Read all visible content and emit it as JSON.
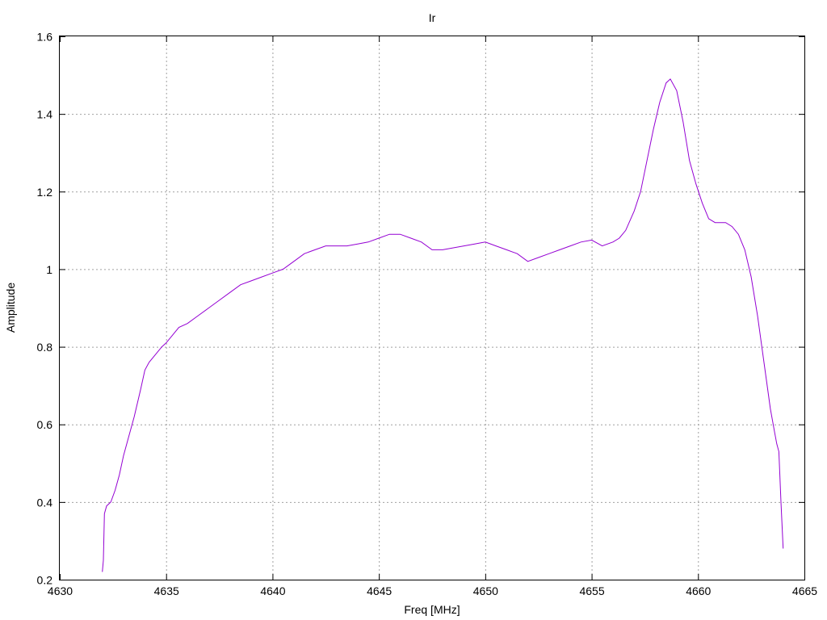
{
  "chart_data": {
    "type": "line",
    "title": "Ir",
    "xlabel": "Freq [MHz]",
    "ylabel": "Amplitude",
    "xlim": [
      4630,
      4665
    ],
    "ylim": [
      0.2,
      1.6
    ],
    "x_ticks": [
      "4630",
      "4635",
      "4640",
      "4645",
      "4650",
      "4655",
      "4660",
      "4665"
    ],
    "y_ticks": [
      "0.2",
      "0.4",
      "0.6",
      "0.8",
      "1",
      "1.2",
      "1.4",
      "1.6"
    ],
    "grid": true,
    "legend": "none",
    "series": [
      {
        "color": "#9400d3",
        "x": [
          4632.0,
          4632.05,
          4632.1,
          4632.2,
          4632.4,
          4632.6,
          4632.8,
          4633.0,
          4633.2,
          4633.5,
          4633.8,
          4634.0,
          4634.2,
          4634.5,
          4634.8,
          4635.0,
          4635.3,
          4635.6,
          4636.0,
          4636.5,
          4637.0,
          4637.5,
          4638.0,
          4638.5,
          4639.0,
          4639.5,
          4640.0,
          4640.5,
          4641.0,
          4641.5,
          4642.0,
          4642.5,
          4643.0,
          4643.5,
          4644.0,
          4644.5,
          4645.0,
          4645.5,
          4646.0,
          4646.5,
          4647.0,
          4647.5,
          4648.0,
          4648.5,
          4649.0,
          4649.5,
          4650.0,
          4650.5,
          4651.0,
          4651.5,
          4652.0,
          4652.5,
          4653.0,
          4653.5,
          4654.0,
          4654.5,
          4655.0,
          4655.5,
          4656.0,
          4656.3,
          4656.6,
          4657.0,
          4657.3,
          4657.6,
          4657.9,
          4658.2,
          4658.5,
          4658.7,
          4659.0,
          4659.3,
          4659.6,
          4659.9,
          4660.2,
          4660.5,
          4660.8,
          4661.0,
          4661.3,
          4661.6,
          4661.9,
          4662.2,
          4662.5,
          4662.8,
          4663.0,
          4663.2,
          4663.4,
          4663.6,
          4663.7,
          4663.8,
          4663.9,
          4664.0
        ],
        "y": [
          0.22,
          0.25,
          0.37,
          0.39,
          0.4,
          0.43,
          0.47,
          0.52,
          0.56,
          0.62,
          0.69,
          0.74,
          0.76,
          0.78,
          0.8,
          0.81,
          0.83,
          0.85,
          0.86,
          0.88,
          0.9,
          0.92,
          0.94,
          0.96,
          0.97,
          0.98,
          0.99,
          1.0,
          1.02,
          1.04,
          1.05,
          1.06,
          1.06,
          1.06,
          1.065,
          1.07,
          1.08,
          1.09,
          1.09,
          1.08,
          1.07,
          1.05,
          1.05,
          1.055,
          1.06,
          1.065,
          1.07,
          1.06,
          1.05,
          1.04,
          1.02,
          1.03,
          1.04,
          1.05,
          1.06,
          1.07,
          1.075,
          1.06,
          1.07,
          1.08,
          1.1,
          1.15,
          1.2,
          1.28,
          1.36,
          1.43,
          1.48,
          1.49,
          1.46,
          1.38,
          1.28,
          1.22,
          1.17,
          1.13,
          1.12,
          1.12,
          1.12,
          1.11,
          1.09,
          1.05,
          0.98,
          0.88,
          0.8,
          0.72,
          0.64,
          0.58,
          0.55,
          0.53,
          0.4,
          0.28
        ]
      }
    ]
  }
}
